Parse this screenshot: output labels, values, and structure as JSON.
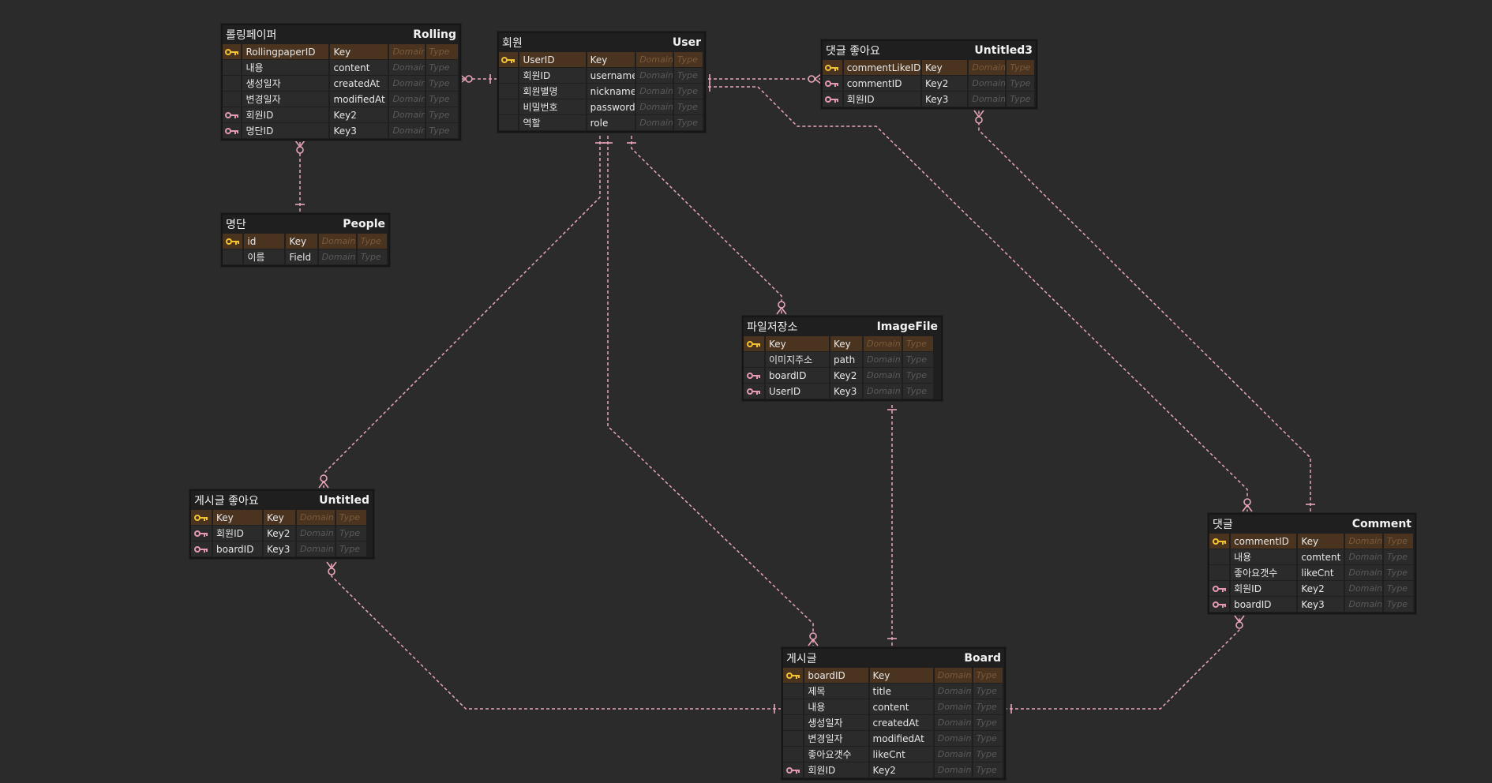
{
  "colors": {
    "background": "#2b2b2b",
    "edge": "#e9a6b8",
    "pk_row": "#4a3420",
    "pk_key_icon": "#f2c233",
    "fk_key_icon": "#e39ab0"
  },
  "placeholders": {
    "domain": "Domain",
    "type": "Type"
  },
  "entities": [
    {
      "id": "rolling",
      "logical": "롤링페이퍼",
      "physical": "Rolling",
      "columns": [
        {
          "key": "pk",
          "logical": "RollingpaperID",
          "physical": "Key"
        },
        {
          "key": "",
          "logical": "내용",
          "physical": "content"
        },
        {
          "key": "",
          "logical": "생성일자",
          "physical": "createdAt"
        },
        {
          "key": "",
          "logical": "변경일자",
          "physical": "modifiedAt"
        },
        {
          "key": "fk",
          "logical": "회원ID",
          "physical": "Key2"
        },
        {
          "key": "fk",
          "logical": "명단ID",
          "physical": "Key3"
        }
      ]
    },
    {
      "id": "user",
      "logical": "회원",
      "physical": "User",
      "columns": [
        {
          "key": "pk",
          "logical": "UserID",
          "physical": "Key"
        },
        {
          "key": "",
          "logical": "회원ID",
          "physical": "username"
        },
        {
          "key": "",
          "logical": "회원별명",
          "physical": "nickname"
        },
        {
          "key": "",
          "logical": "비밀번호",
          "physical": "password"
        },
        {
          "key": "",
          "logical": "역할",
          "physical": "role"
        }
      ]
    },
    {
      "id": "untitled3",
      "logical": "댓글 좋아요",
      "physical": "Untitled3",
      "columns": [
        {
          "key": "pk",
          "logical": "commentLikeID",
          "physical": "Key"
        },
        {
          "key": "fk",
          "logical": "commentID",
          "physical": "Key2"
        },
        {
          "key": "fk",
          "logical": "회원ID",
          "physical": "Key3"
        }
      ]
    },
    {
      "id": "people",
      "logical": "명단",
      "physical": "People",
      "columns": [
        {
          "key": "pk",
          "logical": "id",
          "physical": "Key"
        },
        {
          "key": "",
          "logical": "이름",
          "physical": "Field"
        }
      ]
    },
    {
      "id": "imagefile",
      "logical": "파일저장소",
      "physical": "ImageFile",
      "columns": [
        {
          "key": "pk",
          "logical": "Key",
          "physical": "Key"
        },
        {
          "key": "",
          "logical": "이미지주소",
          "physical": "path"
        },
        {
          "key": "fk",
          "logical": "boardID",
          "physical": "Key2"
        },
        {
          "key": "fk",
          "logical": "UserID",
          "physical": "Key3"
        }
      ]
    },
    {
      "id": "untitled",
      "logical": "게시글 좋아요",
      "physical": "Untitled",
      "columns": [
        {
          "key": "pk",
          "logical": "Key",
          "physical": "Key"
        },
        {
          "key": "fk",
          "logical": "회원ID",
          "physical": "Key2"
        },
        {
          "key": "fk",
          "logical": "boardID",
          "physical": "Key3"
        }
      ]
    },
    {
      "id": "comment",
      "logical": "댓글",
      "physical": "Comment",
      "columns": [
        {
          "key": "pk",
          "logical": "commentID",
          "physical": "Key"
        },
        {
          "key": "",
          "logical": "내용",
          "physical": "comtent"
        },
        {
          "key": "",
          "logical": "좋아요갯수",
          "physical": "likeCnt"
        },
        {
          "key": "fk",
          "logical": "회원ID",
          "physical": "Key2"
        },
        {
          "key": "fk",
          "logical": "boardID",
          "physical": "Key3"
        }
      ]
    },
    {
      "id": "board",
      "logical": "게시글",
      "physical": "Board",
      "columns": [
        {
          "key": "pk",
          "logical": "boardID",
          "physical": "Key"
        },
        {
          "key": "",
          "logical": "제목",
          "physical": "title"
        },
        {
          "key": "",
          "logical": "내용",
          "physical": "content"
        },
        {
          "key": "",
          "logical": "생성일자",
          "physical": "createdAt"
        },
        {
          "key": "",
          "logical": "변경일자",
          "physical": "modifiedAt"
        },
        {
          "key": "",
          "logical": "좋아요갯수",
          "physical": "likeCnt"
        },
        {
          "key": "fk",
          "logical": "회원ID",
          "physical": "Key2"
        }
      ]
    }
  ],
  "relationships": [
    {
      "from": "user",
      "to": "rolling",
      "from_end": "one",
      "to_end": "zero-or-many"
    },
    {
      "from": "user",
      "to": "untitled3",
      "from_end": "one",
      "to_end": "zero-or-many"
    },
    {
      "from": "people",
      "to": "rolling",
      "from_end": "one",
      "to_end": "zero-or-many"
    },
    {
      "from": "user",
      "to": "imagefile",
      "from_end": "one",
      "to_end": "zero-or-many"
    },
    {
      "from": "user",
      "to": "untitled",
      "from_end": "one",
      "to_end": "zero-or-many"
    },
    {
      "from": "user",
      "to": "board",
      "from_end": "one",
      "to_end": "zero-or-many"
    },
    {
      "from": "user",
      "to": "comment",
      "from_end": "one",
      "to_end": "zero-or-many"
    },
    {
      "from": "comment",
      "to": "untitled3",
      "from_end": "one",
      "to_end": "zero-or-many"
    },
    {
      "from": "board",
      "to": "imagefile",
      "from_end": "one",
      "to_end": "one"
    },
    {
      "from": "board",
      "to": "untitled",
      "from_end": "one",
      "to_end": "zero-or-many"
    },
    {
      "from": "board",
      "to": "comment",
      "from_end": "one",
      "to_end": "zero-or-many"
    }
  ]
}
